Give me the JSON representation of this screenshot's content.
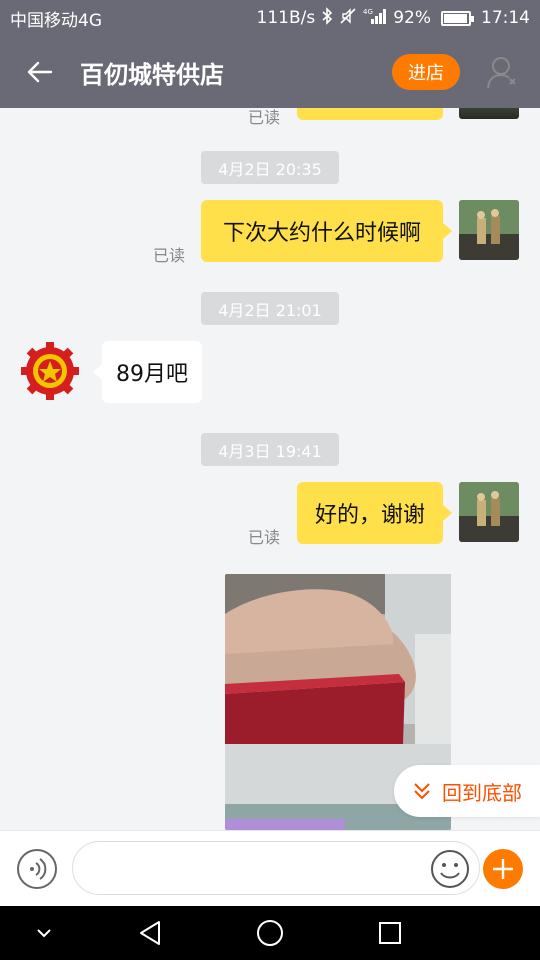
{
  "status": {
    "carrier": "中国移动4G",
    "speed": "111B/s",
    "battery": "92%",
    "time": "17:14"
  },
  "header": {
    "title": "百仞城特供店",
    "enter_label": "进店"
  },
  "messages": {
    "read_label": "已读",
    "time1": "4月2日 20:35",
    "msg1": "下次大约什么时候啊",
    "time2": "4月2日 21:01",
    "msg2": "89月吧",
    "time3": "4月3日 19:41",
    "msg3": "好的，谢谢"
  },
  "back_to_bottom": "回到底部",
  "colors": {
    "header_bg": "#6a6a76",
    "accent": "#ff7a00",
    "my_bubble": "#ffe04a",
    "back_text": "#ff5000"
  }
}
